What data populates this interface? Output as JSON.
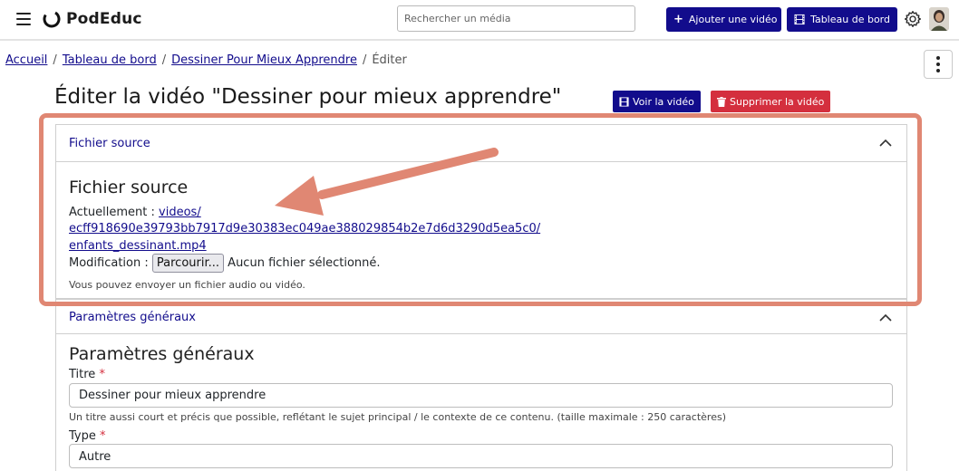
{
  "navbar": {
    "brand": "PodEduc",
    "search_placeholder": "Rechercher un média",
    "add_video_label": "Ajouter une vidéo",
    "dashboard_label": "Tableau de bord"
  },
  "breadcrumb": {
    "items": [
      "Accueil",
      "Tableau de bord",
      "Dessiner Pour Mieux Apprendre"
    ],
    "current": "Éditer",
    "separator": "/"
  },
  "page": {
    "title": "Éditer la vidéo \"Dessiner pour mieux apprendre\"",
    "view_button": "Voir la vidéo",
    "delete_button": "Supprimer la vidéo"
  },
  "source_section": {
    "header": "Fichier source",
    "title": "Fichier source",
    "current_label": "Actuellement :",
    "file_link_line1": "videos/",
    "file_link_line2": "ecff918690e39793bb7917d9e30383ec049ae388029854b2e7d6d3290d5ea5c0/",
    "file_link_line3": "enfants_dessinant.mp4",
    "modification_label": "Modification :",
    "browse_button": "Parcourir...",
    "no_file": "Aucun fichier sélectionné.",
    "help": "Vous pouvez envoyer un fichier audio ou vidéo."
  },
  "general_section": {
    "header": "Paramètres généraux",
    "title": "Paramètres généraux",
    "title_label": "Titre",
    "required_mark": "*",
    "title_value": "Dessiner pour mieux apprendre",
    "title_help": "Un titre aussi court et précis que possible, reflétant le sujet principal / le contexte de ce contenu. (taille maximale : 250 caractères)",
    "type_label": "Type",
    "type_value": "Autre"
  },
  "colors": {
    "primary": "#120c8c",
    "danger": "#d42f3e",
    "annotation": "#e08773"
  }
}
